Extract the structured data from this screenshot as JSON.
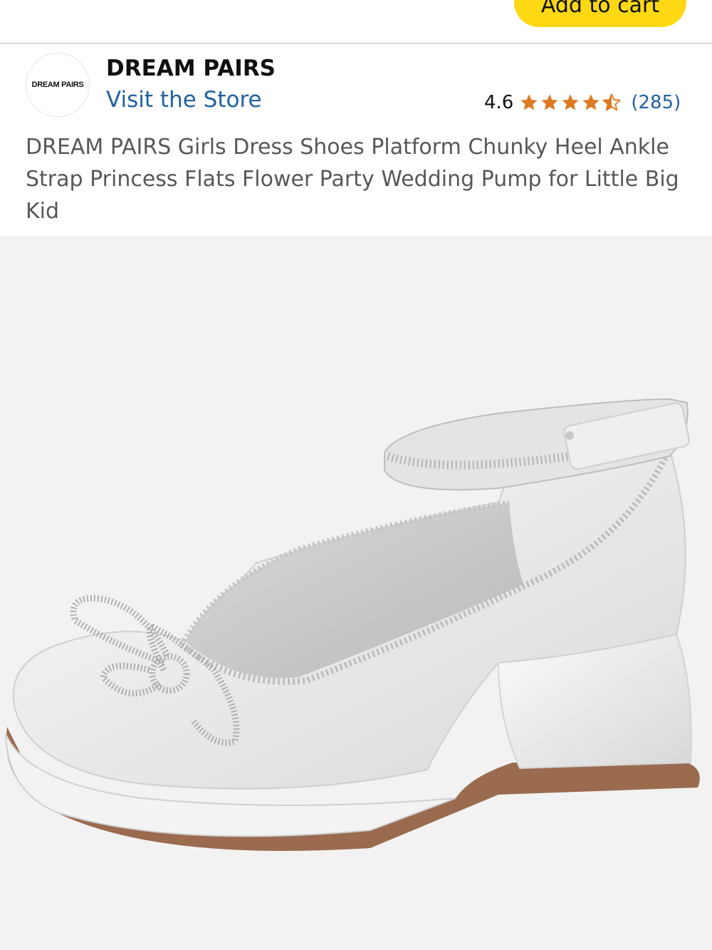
{
  "header": {
    "cart_button_label": "Add to cart"
  },
  "brand": {
    "logo_text": "DREAM PAIRS",
    "name": "DREAM PAIRS",
    "store_link": "Visit the Store"
  },
  "rating": {
    "score": "4.6",
    "value": 4.6,
    "max": 5,
    "count": "(285)",
    "star_color": "#de7921"
  },
  "product": {
    "title": "DREAM PAIRS Girls Dress Shoes Platform Chunky Heel Ankle Strap Princess Flats Flower Party Wedding Pump for Little Big Kid",
    "image": "white-satin-mary-jane-shoe-with-rhinestone-bow"
  },
  "colors": {
    "link": "#2162a1",
    "cart_button": "#ffd814",
    "image_background": "#f2f2f2"
  }
}
